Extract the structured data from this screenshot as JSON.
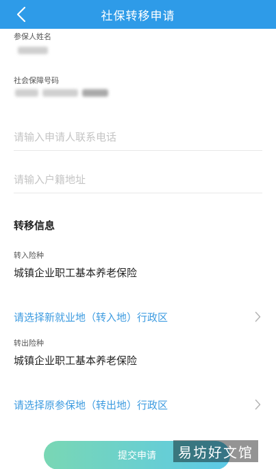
{
  "header": {
    "title": "社保转移申请",
    "back_icon": "chevron-left-icon",
    "background_color": "#2e9be8"
  },
  "insured_name": {
    "label": "参保人姓名"
  },
  "social_security_number": {
    "label": "社会保障号码"
  },
  "phone_input": {
    "value": "",
    "placeholder": "请输入申请人联系电话"
  },
  "address_input": {
    "value": "",
    "placeholder": "请输入户籍地址"
  },
  "transfer_info": {
    "title": "转移信息",
    "in_insurance": {
      "label": "转入险种",
      "value": "城镇企业职工基本养老保险"
    },
    "in_region": {
      "label": "请选择新就业地（转入地）行政区",
      "icon": "chevron-right-icon"
    },
    "out_insurance": {
      "label": "转出险种",
      "value": "城镇企业职工基本养老保险"
    },
    "out_region": {
      "label": "请选择原参保地（转出地）行政区",
      "icon": "chevron-right-icon"
    }
  },
  "submit_button": {
    "label": "提交申请"
  },
  "watermark": {
    "text": "易坊好文馆"
  },
  "colors": {
    "accent": "#3d9be0",
    "button_gradient_start": "#79d7b4",
    "button_gradient_end": "#5cc9e7"
  }
}
